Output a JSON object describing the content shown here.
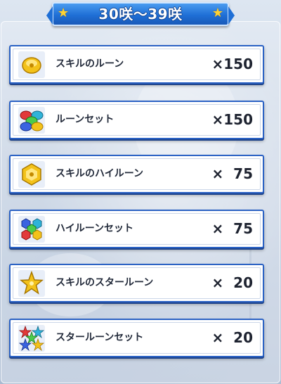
{
  "header": {
    "title": "30咲～39咲"
  },
  "rewards": [
    {
      "label": "スキルのルーン",
      "quantity": "×150",
      "icon": "rune-icon"
    },
    {
      "label": "ルーンセット",
      "quantity": "×150",
      "icon": "rune-set-icon"
    },
    {
      "label": "スキルのハイルーン",
      "quantity": "×  75",
      "icon": "high-rune-icon"
    },
    {
      "label": "ハイルーンセット",
      "quantity": "×  75",
      "icon": "high-rune-set-icon"
    },
    {
      "label": "スキルのスタールーン",
      "quantity": "×  20",
      "icon": "star-rune-icon"
    },
    {
      "label": "スタールーンセット",
      "quantity": "×  20",
      "icon": "star-rune-set-icon"
    }
  ],
  "colors": {
    "ribbon": "#1f6fd6",
    "row_border": "#2b62c4",
    "star": "#ffd233"
  }
}
